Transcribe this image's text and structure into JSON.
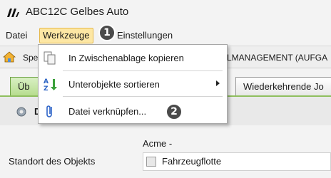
{
  "window": {
    "title": "ABC12C Gelbes Auto",
    "logo_icon": "app-logo-icon"
  },
  "menubar": {
    "items": [
      {
        "label": "Datei"
      },
      {
        "label": "Werkzeuge"
      },
      {
        "label": "Einstellungen"
      }
    ],
    "active_index": 1
  },
  "toolbar": {
    "left_label": "Spe",
    "right_label": "LMANAGEMENT (AUFGA"
  },
  "tabs": {
    "items": [
      {
        "label": "Üb"
      },
      {
        "label": "Wiederkehrende Jo"
      }
    ]
  },
  "content": {
    "header_label": "D"
  },
  "form": {
    "caption": "Acme -",
    "label": "Standort des Objekts",
    "value": "Fahrzeugflotte"
  },
  "dropdown": {
    "items": [
      {
        "label": "In Zwischenablage kopieren",
        "icon": "copy-icon"
      },
      {
        "label": "Unterobjekte sortieren",
        "icon": "sort-az-icon",
        "has_submenu": true
      },
      {
        "label": "Datei verknüpfen...",
        "icon": "paperclip-icon"
      }
    ]
  },
  "callouts": [
    "1",
    "2"
  ],
  "colors": {
    "accent_green": "#8fbf5e",
    "menu_highlight": "#fde7a4",
    "callout_bg": "#4a4a4a"
  }
}
